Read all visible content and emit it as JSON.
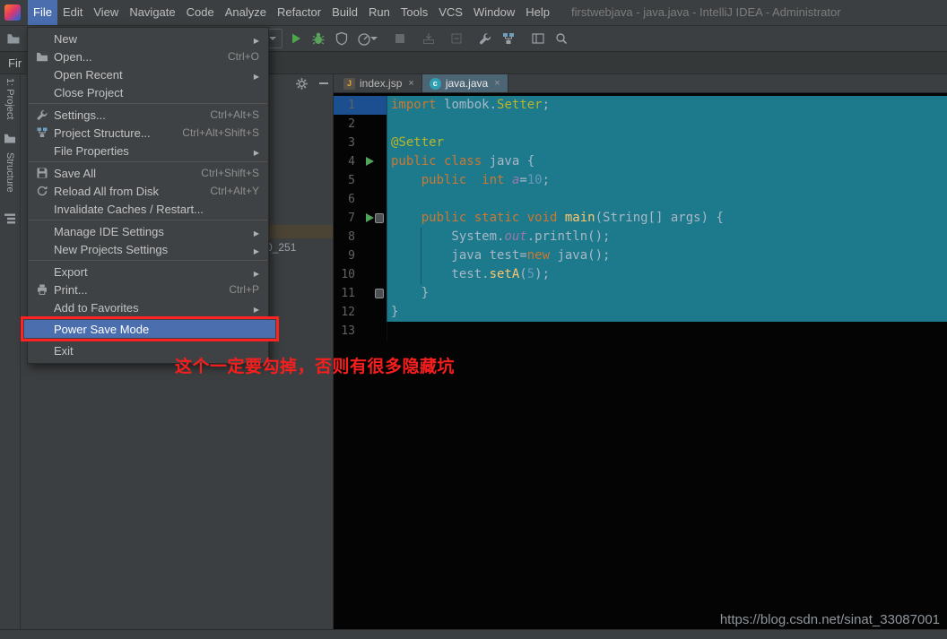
{
  "window": {
    "title": "firstwebjava - java.java - IntelliJ IDEA - Administrator"
  },
  "menubar": {
    "items": [
      "File",
      "Edit",
      "View",
      "Navigate",
      "Code",
      "Analyze",
      "Refactor",
      "Build",
      "Run",
      "Tools",
      "VCS",
      "Window",
      "Help"
    ],
    "active_item": "File"
  },
  "toolbar": {
    "icons": [
      "open-folder",
      "run-config-caret",
      "run",
      "debug",
      "run-with-coverage",
      "profiler",
      "stop",
      "update-project",
      "open-in-new",
      "settings-wrench",
      "project-structure",
      "layout-editor",
      "search-everywhere"
    ]
  },
  "navbar": {
    "breadcrumb": "Fir"
  },
  "left_stripe": {
    "items": [
      "1: Project",
      "Structure"
    ]
  },
  "project_panel": {
    "header_icons": [
      "settings-gear",
      "hide"
    ],
    "selected_item_fragment": "0_251"
  },
  "file_menu": {
    "items": [
      {
        "label": "New",
        "submenu": true
      },
      {
        "label": "Open...",
        "shortcut": "Ctrl+O",
        "icon": "folder-icon"
      },
      {
        "label": "Open Recent",
        "submenu": true
      },
      {
        "label": "Close Project"
      },
      {
        "separator": true
      },
      {
        "label": "Settings...",
        "shortcut": "Ctrl+Alt+S",
        "icon": "wrench-icon"
      },
      {
        "label": "Project Structure...",
        "shortcut": "Ctrl+Alt+Shift+S",
        "icon": "structure-icon"
      },
      {
        "label": "File Properties",
        "submenu": true
      },
      {
        "separator": true
      },
      {
        "label": "Save All",
        "shortcut": "Ctrl+Shift+S",
        "icon": "save-icon"
      },
      {
        "label": "Reload All from Disk",
        "shortcut": "Ctrl+Alt+Y",
        "icon": "reload-icon"
      },
      {
        "label": "Invalidate Caches / Restart..."
      },
      {
        "separator": true
      },
      {
        "label": "Manage IDE Settings",
        "submenu": true
      },
      {
        "label": "New Projects Settings",
        "submenu": true
      },
      {
        "separator": true
      },
      {
        "label": "Export",
        "submenu": true
      },
      {
        "label": "Print...",
        "shortcut": "Ctrl+P",
        "icon": "printer-icon"
      },
      {
        "label": "Add to Favorites",
        "submenu": true
      },
      {
        "label": "Power Save Mode",
        "highlighted": true
      },
      {
        "label": "Exit"
      }
    ]
  },
  "editor": {
    "tabs": [
      {
        "label": "index.jsp",
        "icon": "jsp-file-icon"
      },
      {
        "label": "java.java",
        "icon": "class-icon",
        "active": true
      }
    ],
    "gutter": {
      "run_icon_lines": [
        4,
        7
      ],
      "marker_icon_lines": [
        7,
        11
      ]
    },
    "lines": [
      {
        "n": "1",
        "parts": [
          {
            "t": "import ",
            "c": "tk-kw"
          },
          {
            "t": "lombok.",
            "c": "tk-pl"
          },
          {
            "t": "Setter",
            "c": "tk-ann"
          },
          {
            "t": ";",
            "c": "tk-pl"
          }
        ]
      },
      {
        "n": "2",
        "parts": []
      },
      {
        "n": "3",
        "parts": [
          {
            "t": "@Setter",
            "c": "tk-ann"
          }
        ]
      },
      {
        "n": "4",
        "parts": [
          {
            "t": "public class ",
            "c": "tk-kw"
          },
          {
            "t": "java {",
            "c": "tk-pl"
          }
        ]
      },
      {
        "n": "5",
        "parts": [
          {
            "t": "    ",
            "c": "tk-pl"
          },
          {
            "t": "public  int ",
            "c": "tk-kw"
          },
          {
            "t": "a",
            "c": "tk-fld"
          },
          {
            "t": "=",
            "c": "tk-pl"
          },
          {
            "t": "10",
            "c": "tk-num"
          },
          {
            "t": ";",
            "c": "tk-pl"
          }
        ]
      },
      {
        "n": "6",
        "parts": []
      },
      {
        "n": "7",
        "parts": [
          {
            "t": "    ",
            "c": "tk-pl"
          },
          {
            "t": "public static void ",
            "c": "tk-kw"
          },
          {
            "t": "main",
            "c": "tk-fn"
          },
          {
            "t": "(String[] args) {",
            "c": "tk-pl"
          }
        ]
      },
      {
        "n": "8",
        "parts": [
          {
            "t": "        System.",
            "c": "tk-pl"
          },
          {
            "t": "out",
            "c": "tk-fld"
          },
          {
            "t": ".println();",
            "c": "tk-pl"
          }
        ]
      },
      {
        "n": "9",
        "parts": [
          {
            "t": "        java test=",
            "c": "tk-pl"
          },
          {
            "t": "new ",
            "c": "tk-kw"
          },
          {
            "t": "java();",
            "c": "tk-pl"
          }
        ]
      },
      {
        "n": "10",
        "parts": [
          {
            "t": "        test.",
            "c": "tk-pl"
          },
          {
            "t": "setA",
            "c": "tk-fn"
          },
          {
            "t": "(",
            "c": "tk-pl"
          },
          {
            "t": "5",
            "c": "tk-num"
          },
          {
            "t": ");",
            "c": "tk-pl"
          }
        ]
      },
      {
        "n": "11",
        "parts": [
          {
            "t": "    }",
            "c": "tk-pl"
          }
        ]
      },
      {
        "n": "12",
        "parts": [
          {
            "t": "}",
            "c": "tk-pl"
          }
        ]
      },
      {
        "n": "13",
        "parts": []
      }
    ]
  },
  "annotation": {
    "text": "这个一定要勾掉，否则有很多隐藏坑",
    "box_target": "Power Save Mode"
  },
  "watermark": {
    "text": "https://blog.csdn.net/sinat_33087001"
  },
  "palette": {
    "kw": "#CC7832",
    "pl": "#A9B7C6",
    "ann": "#BBB529",
    "fn": "#FFC66D",
    "fld": "#9876AA",
    "num": "#6897BB",
    "teal": "#1C7A8C",
    "menusel": "#4B6EAF",
    "red": "#FF2222",
    "panel": "#3C3F41",
    "editorbg": "#040404",
    "gutterblue": "#1C4F8F",
    "rungreen": "#4FA65A"
  }
}
